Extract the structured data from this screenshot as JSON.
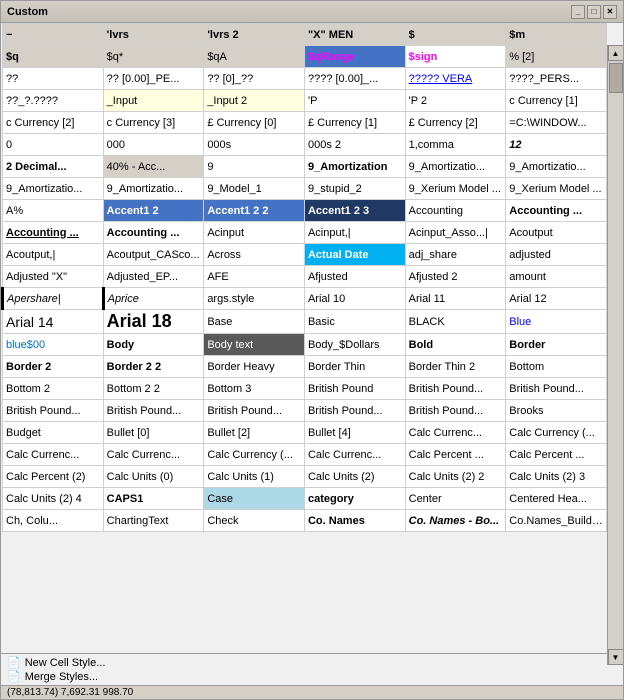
{
  "window": {
    "title": "Custom"
  },
  "grid": {
    "rows": [
      [
        "−",
        "'lvrs",
        "'lvrs 2",
        "\"X\" MEN",
        "$",
        "$m"
      ],
      [
        "$q",
        "$q*",
        "$qA",
        "$qRange",
        "$sign",
        "% [2]"
      ],
      [
        "??",
        "?? [0.00]_PE...",
        "?? [0]_??",
        "???? [0.00]_...",
        "????? VERA",
        "????_PERS..."
      ],
      [
        "??_?.????",
        "_Input",
        "_Input 2",
        "'P",
        "'P 2",
        "c Currency [1]"
      ],
      [
        "c Currency [2]",
        "c Currency [3]",
        "£ Currency [0]",
        "£ Currency [1]",
        "£ Currency [2]",
        "=C:\\WINDOW..."
      ],
      [
        "0",
        "000",
        "000s",
        "000s 2",
        "1,comma",
        "12"
      ],
      [
        "2 Decimal...",
        "40% - Acc...",
        "9",
        "9_Amortization",
        "9_Amortizatio...",
        "9_Amortizatio..."
      ],
      [
        "9_Amortizatio...",
        "9_Amortizatio...",
        "9_Model_1",
        "9_stupid_2",
        "9_Xerium Model ...",
        "9_Xerium Model ..."
      ],
      [
        "A%",
        "Accent1 2",
        "Accent1 2 2",
        "Accent1 2 3",
        "Accounting",
        "Accounting ..."
      ],
      [
        "Accounting ...",
        "Accounting ...",
        "Acinput",
        "Acinput,|",
        "Acinput_Asso...|",
        "Acoutput"
      ],
      [
        "Acoutput,|",
        "Acoutput_CASco...",
        "Across",
        "Actual Date",
        "adj_share",
        "adjusted"
      ],
      [
        "Adjusted \"X\"",
        "Adjusted_EP...",
        "AFE",
        "Afjusted",
        "Afjusted 2",
        "amount"
      ],
      [
        "Apershare|",
        "Aprice",
        "args.style",
        "Arial 10",
        "Arial 11",
        "Arial 12"
      ],
      [
        "Arial 14",
        "Arial 18",
        "Base",
        "Basic",
        "BLACK",
        "Blue"
      ],
      [
        "blue$00",
        "Body",
        "Body text",
        "Body_$Dollars",
        "Bold",
        "Border"
      ],
      [
        "Border 2",
        "Border 2 2",
        "Border Heavy",
        "Border Thin",
        "Border Thin 2",
        "Bottom"
      ],
      [
        "Bottom 2",
        "Bottom 2 2",
        "Bottom 3",
        "British Pound",
        "British Pound...",
        "British Pound..."
      ],
      [
        "British Pound...",
        "British Pound...",
        "British Pound...",
        "British Pound...",
        "British Pound...",
        "Brooks"
      ],
      [
        "Budget",
        "Bullet [0]",
        "Bullet [2]",
        "Bullet [4]",
        "Calc Currenc...",
        "Calc Currency (..."
      ],
      [
        "Calc Currenc...",
        "Calc Currenc...",
        "Calc Currency (...",
        "Calc Currenc...",
        "Calc Percent ...",
        "Calc Percent ..."
      ],
      [
        "Calc Percent (2)",
        "Calc Units (0)",
        "Calc Units (1)",
        "Calc Units (2)",
        "Calc Units (2) 2",
        "Calc Units (2) 3"
      ],
      [
        "Calc Units (2) 4",
        "CAPS1",
        "Case",
        "category",
        "Center",
        "Centered Hea..."
      ],
      [
        "Ch, Colu...",
        "ChartingText",
        "Check",
        "Co. Names",
        "Co. Names - Bo...",
        "Co.Names_Buildup..."
      ]
    ],
    "row_styles": [
      [
        "gray-bg bold",
        "gray-bg",
        "gray-bg",
        "gray-bg",
        "gray-bg",
        "gray-bg"
      ],
      [
        "gray-bg bold",
        "gray-bg",
        "gray-bg",
        "gray-bg blue-bg magenta",
        "gray-bg",
        "gray-bg"
      ],
      [
        "",
        "",
        "",
        "",
        "blue underline",
        ""
      ],
      [
        "",
        "light-yellow-bg",
        "light-yellow-bg",
        "",
        "",
        ""
      ],
      [
        "",
        "",
        "",
        "",
        "",
        ""
      ],
      [
        "",
        "",
        "",
        "",
        "",
        "italic bold"
      ],
      [
        "bold",
        "gray-bg",
        "",
        "bold",
        "",
        ""
      ],
      [
        "",
        "",
        "",
        "",
        "",
        ""
      ],
      [
        "",
        "blue-bg",
        "blue-bg",
        "dark-blue-bg",
        "",
        "bold"
      ],
      [
        "underline bold",
        "bold",
        "",
        "",
        "",
        ""
      ],
      [
        "",
        "",
        "",
        "cyan-bg",
        "",
        ""
      ],
      [
        "",
        "",
        "",
        "",
        "",
        ""
      ],
      [
        "left-thick italic",
        "left-thick italic",
        "",
        "",
        "",
        ""
      ],
      [
        "arial14",
        "arial18",
        "",
        "",
        "",
        "blue"
      ],
      [
        "font-blue00",
        "bold",
        "dark-gray-bg",
        "",
        "bold",
        "bold"
      ],
      [
        "bold",
        "bold",
        "",
        "",
        "",
        ""
      ],
      [
        "",
        "",
        "",
        "",
        "",
        ""
      ],
      [
        "",
        "",
        "",
        "",
        "",
        ""
      ],
      [
        "",
        "",
        "",
        "",
        "",
        ""
      ],
      [
        "",
        "",
        "",
        "",
        "",
        ""
      ],
      [
        "",
        "",
        "",
        "",
        "",
        ""
      ],
      [
        "",
        "bold",
        "light-blue-bg",
        "bold",
        "",
        ""
      ],
      [
        "",
        "",
        "",
        "",
        "italic",
        ""
      ]
    ]
  },
  "bottom_bar": {
    "new_cell_style": "New Cell Style...",
    "merge_styles": "Merge Styles..."
  },
  "status_bar": {
    "values": "(78,813.74)     7,692.31     998.70"
  }
}
